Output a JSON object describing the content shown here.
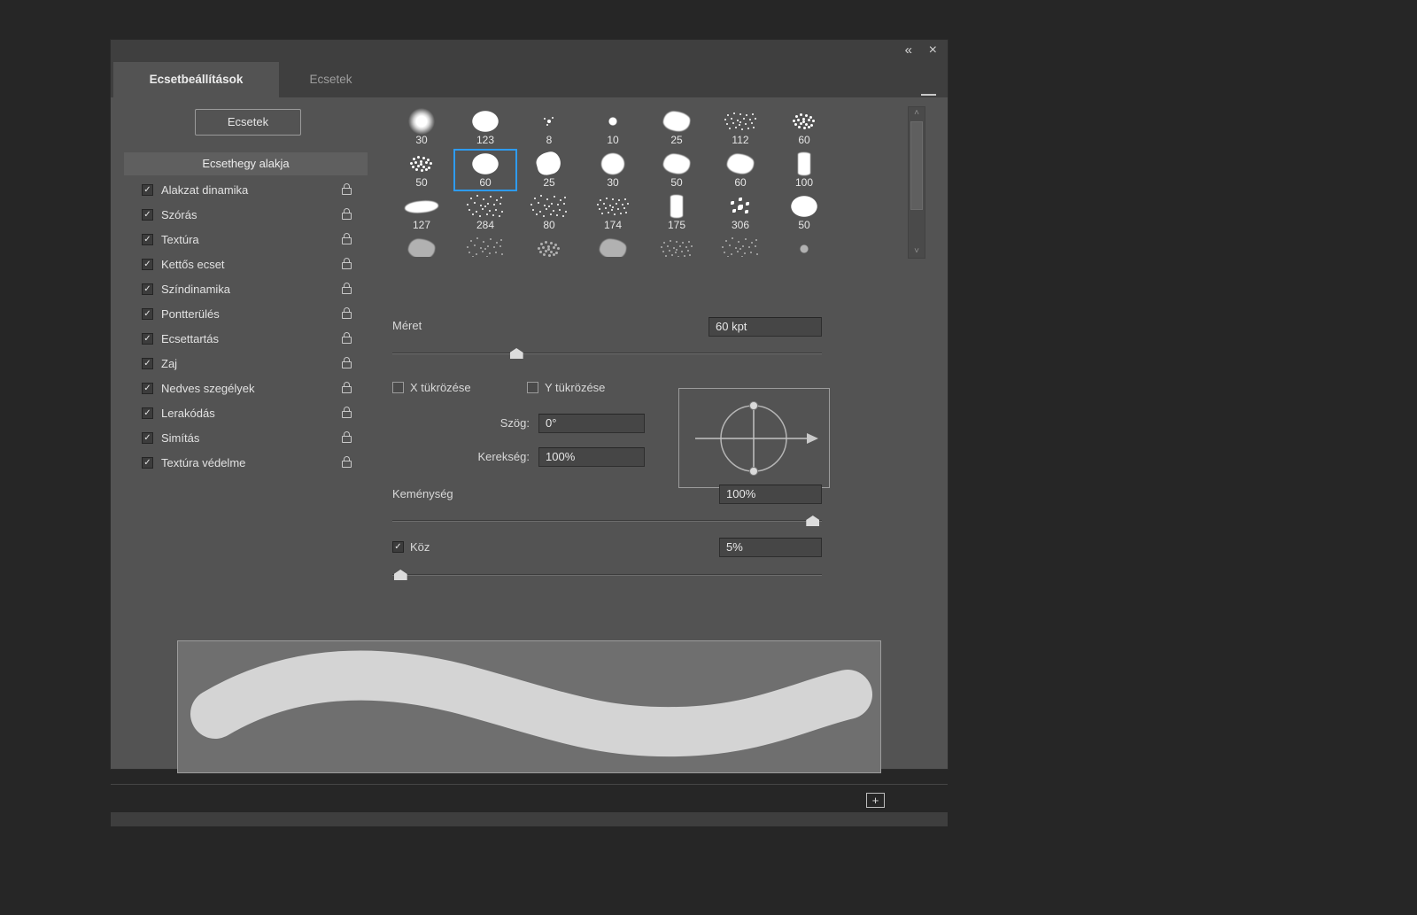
{
  "icons": {
    "collapse": "«",
    "close": "×",
    "scroll_up": "˄",
    "scroll_down": "˅",
    "plus": "+",
    "check": "✓"
  },
  "tabs": [
    {
      "label": "Ecsetbeállítások",
      "active": true
    },
    {
      "label": "Ecsetek",
      "active": false
    }
  ],
  "sidebar": {
    "brushes_button": "Ecsetek",
    "tip_shape_item": "Ecsethegy alakja",
    "items": [
      {
        "label": "Alakzat dinamika",
        "checked": true
      },
      {
        "label": "Szórás",
        "checked": true
      },
      {
        "label": "Textúra",
        "checked": true
      },
      {
        "label": "Kettős ecset",
        "checked": true
      },
      {
        "label": "Színdinamika",
        "checked": true
      },
      {
        "label": "Pontterülés",
        "checked": true
      },
      {
        "label": "Ecsettartás",
        "checked": true
      },
      {
        "label": "Zaj",
        "checked": true
      },
      {
        "label": "Nedves szegélyek",
        "checked": true
      },
      {
        "label": "Lerakódás",
        "checked": true
      },
      {
        "label": "Simítás",
        "checked": true
      },
      {
        "label": "Textúra védelme",
        "checked": true
      }
    ]
  },
  "brush_grid": {
    "items": [
      {
        "size": "30",
        "type": "soft"
      },
      {
        "size": "123",
        "type": "hard"
      },
      {
        "size": "8",
        "type": "splat"
      },
      {
        "size": "10",
        "type": "dot"
      },
      {
        "size": "25",
        "type": "chalk"
      },
      {
        "size": "112",
        "type": "grain"
      },
      {
        "size": "60",
        "type": "speck"
      },
      {
        "size": "50",
        "type": "speck"
      },
      {
        "size": "60",
        "type": "hard",
        "selected": true
      },
      {
        "size": "25",
        "type": "blob"
      },
      {
        "size": "30",
        "type": "rough"
      },
      {
        "size": "50",
        "type": "chalk"
      },
      {
        "size": "60",
        "type": "chalk"
      },
      {
        "size": "100",
        "type": "grainv"
      },
      {
        "size": "127",
        "type": "flat"
      },
      {
        "size": "284",
        "type": "spray"
      },
      {
        "size": "80",
        "type": "spray"
      },
      {
        "size": "174",
        "type": "grain"
      },
      {
        "size": "175",
        "type": "grainv"
      },
      {
        "size": "306",
        "type": "leaves"
      },
      {
        "size": "50",
        "type": "hard"
      },
      {
        "size": "",
        "type": "chalk",
        "dim": true
      },
      {
        "size": "",
        "type": "spray",
        "dim": true
      },
      {
        "size": "",
        "type": "speck",
        "dim": true
      },
      {
        "size": "",
        "type": "chalk",
        "dim": true
      },
      {
        "size": "",
        "type": "grain",
        "dim": true
      },
      {
        "size": "",
        "type": "spray",
        "dim": true
      },
      {
        "size": "",
        "type": "dot",
        "dim": true
      }
    ]
  },
  "controls": {
    "size_label": "Méret",
    "size_value": "60 kpt",
    "size_slider_pct": 29,
    "flip_x": "X tükrözése",
    "flip_y": "Y tükrözése",
    "angle_label": "Szög:",
    "angle_value": "0°",
    "roundness_label": "Kerekség:",
    "roundness_value": "100%",
    "hardness_label": "Keménység",
    "hardness_value": "100%",
    "hardness_slider_pct": 98,
    "spacing_label": "Köz",
    "spacing_value": "5%",
    "spacing_checked": true,
    "spacing_slider_pct": 2
  }
}
